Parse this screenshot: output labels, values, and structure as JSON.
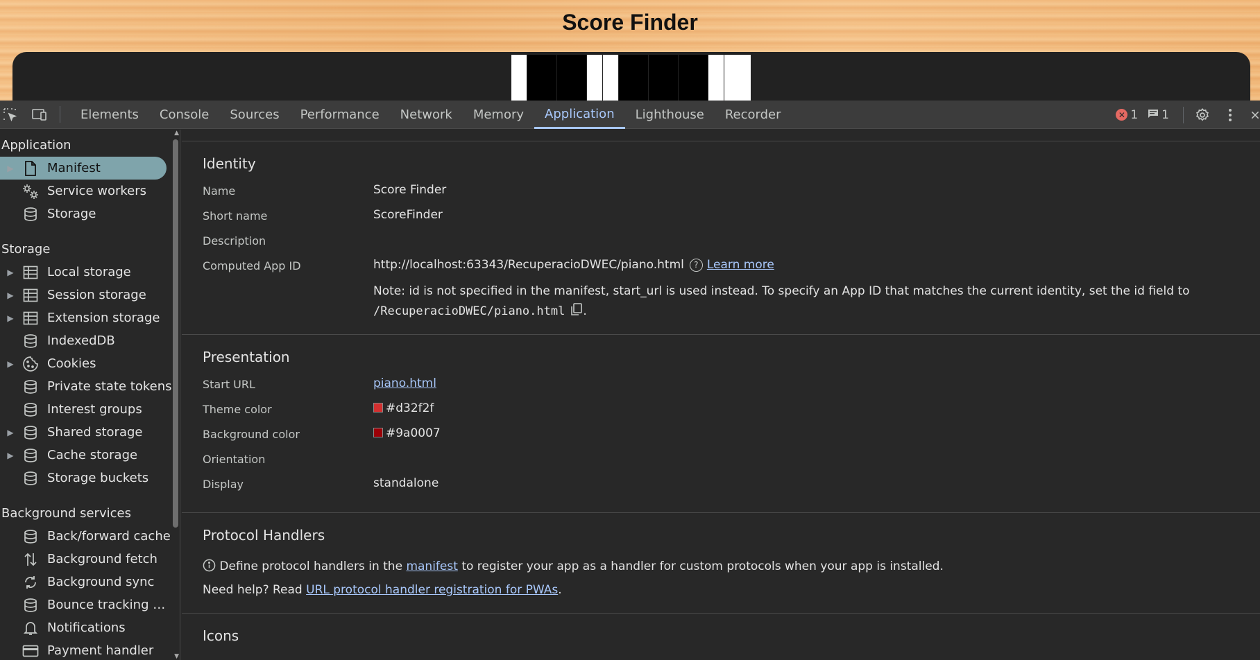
{
  "page": {
    "title": "Score Finder"
  },
  "toolbar": {
    "tabs": [
      "Elements",
      "Console",
      "Sources",
      "Performance",
      "Network",
      "Memory",
      "Application",
      "Lighthouse",
      "Recorder"
    ],
    "active_tab": "Application",
    "error_count": "1",
    "message_count": "1"
  },
  "sidebar": {
    "groups": [
      {
        "title": "Application",
        "items": [
          {
            "label": "Manifest",
            "icon": "file-icon",
            "caret": true,
            "selected": true
          },
          {
            "label": "Service workers",
            "icon": "gears-icon",
            "caret": false
          },
          {
            "label": "Storage",
            "icon": "database-icon",
            "caret": false
          }
        ]
      },
      {
        "title": "Storage",
        "items": [
          {
            "label": "Local storage",
            "icon": "table-icon",
            "caret": true
          },
          {
            "label": "Session storage",
            "icon": "table-icon",
            "caret": true
          },
          {
            "label": "Extension storage",
            "icon": "table-icon",
            "caret": true
          },
          {
            "label": "IndexedDB",
            "icon": "database-icon",
            "caret": false
          },
          {
            "label": "Cookies",
            "icon": "cookie-icon",
            "caret": true
          },
          {
            "label": "Private state tokens",
            "icon": "database-icon",
            "caret": false
          },
          {
            "label": "Interest groups",
            "icon": "database-icon",
            "caret": false
          },
          {
            "label": "Shared storage",
            "icon": "database-icon",
            "caret": true
          },
          {
            "label": "Cache storage",
            "icon": "database-icon",
            "caret": true
          },
          {
            "label": "Storage buckets",
            "icon": "database-icon",
            "caret": false
          }
        ]
      },
      {
        "title": "Background services",
        "items": [
          {
            "label": "Back/forward cache",
            "icon": "database-icon",
            "caret": false
          },
          {
            "label": "Background fetch",
            "icon": "updown-arrows-icon",
            "caret": false
          },
          {
            "label": "Background sync",
            "icon": "sync-icon",
            "caret": false
          },
          {
            "label": "Bounce tracking …",
            "icon": "database-icon",
            "caret": false
          },
          {
            "label": "Notifications",
            "icon": "bell-icon",
            "caret": false
          },
          {
            "label": "Payment handler",
            "icon": "card-icon",
            "caret": false
          }
        ]
      }
    ]
  },
  "identity": {
    "title": "Identity",
    "name_label": "Name",
    "name_value": "Score Finder",
    "short_name_label": "Short name",
    "short_name_value": "ScoreFinder",
    "description_label": "Description",
    "app_id_label": "Computed App ID",
    "app_id_value": "http://localhost:63343/RecuperacioDWEC/piano.html",
    "learn_more": "Learn more",
    "note_text": "Note: id is not specified in the manifest, start_url is used instead. To specify an App ID that matches the current identity, set the id field to",
    "note_path": "/RecuperacioDWEC/piano.html",
    "note_end": "."
  },
  "presentation": {
    "title": "Presentation",
    "start_url_label": "Start URL",
    "start_url_value": "piano.html",
    "theme_color_label": "Theme color",
    "theme_color_value": "#d32f2f",
    "bg_color_label": "Background color",
    "bg_color_value": "#9a0007",
    "orientation_label": "Orientation",
    "display_label": "Display",
    "display_value": "standalone"
  },
  "protocol": {
    "title": "Protocol Handlers",
    "text_before": "Define protocol handlers in the",
    "manifest_link": "manifest",
    "text_after": "to register your app as a handler for custom protocols when your app is installed.",
    "help_prefix": "Need help? Read",
    "help_link": "URL protocol handler registration for PWAs",
    "help_suffix": "."
  },
  "icons": {
    "title": "Icons"
  }
}
